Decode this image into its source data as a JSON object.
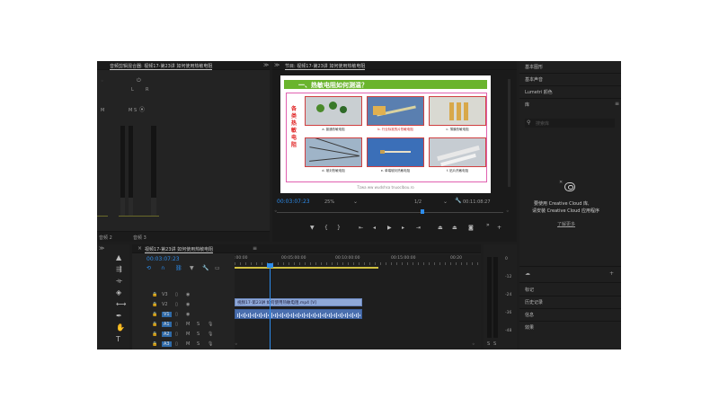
{
  "mixer": {
    "tab": "音频剪辑混合器: 视频17-第23讲 如何使用热敏电阻",
    "ch1_label": "音频 2",
    "ch2_label": "音频 3",
    "ch2_sub": "左/右",
    "m": "M",
    "s": "S",
    "knob_left": "L",
    "knob_right": "R",
    "db_top": "0.0"
  },
  "program": {
    "tab": "节目: 视频17-第23讲 如何使用热敏电阻",
    "timecode": "00:03:07:23",
    "zoom": "25%",
    "quality": "1/2",
    "duration": "00:11:08:27"
  },
  "slide": {
    "title": "一、热敏电阻如何测温？",
    "side_label": "各类热敏电阻",
    "captions": [
      "a. 普通热敏电阻",
      "b. 行业标准的片热敏电阻",
      "c. 薄膜热敏电阻",
      "d. 玻封热敏电阻",
      "e. 单端玻封热敏电阻",
      "f. 贴片热敏电阻"
    ],
    "url": "Tzwa ww wudshsa tnuoclbou.ro"
  },
  "right": {
    "items": [
      "基本图形",
      "基本声音",
      "Lumetri 颜色",
      "库"
    ],
    "search_placeholder": "搜索库",
    "cc_msg1": "要使用 Creative Cloud 库,",
    "cc_msg2": "请安装 Creative Cloud 应用程序",
    "cc_link": "了解更多",
    "lower": [
      "标记",
      "历史记录",
      "信息",
      "效果"
    ]
  },
  "timeline": {
    "tab": "视频17-第23讲 如何使用热敏电阻",
    "timecode": "00:03:07:23",
    "ruler": [
      ":00:00",
      "00:05:00:00",
      "00:10:00:00",
      "00:15:00:00",
      "00:20"
    ],
    "tracks": [
      {
        "id": "V3",
        "kind": "v"
      },
      {
        "id": "V2",
        "kind": "v"
      },
      {
        "id": "V1",
        "kind": "v"
      },
      {
        "id": "A1",
        "kind": "a"
      },
      {
        "id": "A2",
        "kind": "a"
      },
      {
        "id": "A3",
        "kind": "a"
      }
    ],
    "clip_label": "视频17-第23讲 如何使用热敏电阻.mp4 [V]",
    "v1_tag": "V1",
    "a1_tag": "A1"
  },
  "ameters": {
    "scale": [
      "0",
      "-12",
      "-24",
      "-36",
      "-48"
    ],
    "solo": [
      "S",
      "S"
    ]
  },
  "colors": {
    "accent_blue": "#2d8ceb",
    "slide_green": "#6ab42d",
    "clip_video": "#8fa9d9",
    "clip_audio": "#4a6fae"
  }
}
